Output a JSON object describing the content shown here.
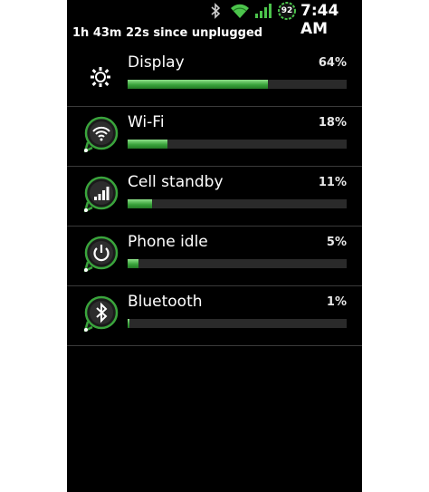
{
  "status_bar": {
    "battery_level": "92",
    "time": "7:44 AM",
    "icons": [
      "bluetooth-icon",
      "wifi-icon",
      "signal-icon",
      "battery-icon"
    ]
  },
  "summary": "1h 43m 22s since unplugged",
  "accent_color": "#3aa43c",
  "items": [
    {
      "name": "Display",
      "percent_label": "64%",
      "percent": 64,
      "icon": "brightness-icon"
    },
    {
      "name": "Wi-Fi",
      "percent_label": "18%",
      "percent": 18,
      "icon": "wifi-icon"
    },
    {
      "name": "Cell standby",
      "percent_label": "11%",
      "percent": 11,
      "icon": "signal-icon"
    },
    {
      "name": "Phone idle",
      "percent_label": "5%",
      "percent": 5,
      "icon": "power-icon"
    },
    {
      "name": "Bluetooth",
      "percent_label": "1%",
      "percent": 1,
      "icon": "bluetooth-icon"
    }
  ]
}
